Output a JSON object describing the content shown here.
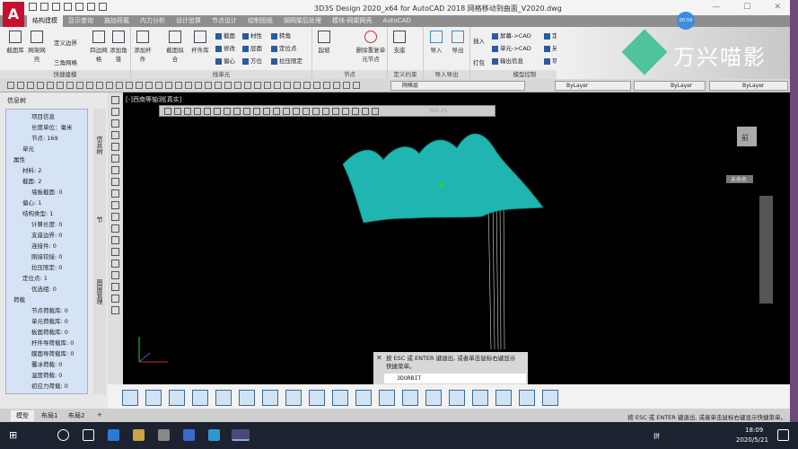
{
  "app": {
    "logo": "A",
    "title": "3D3S Design 2020_x64 for AutoCAD 2018     网格移动到曲面_V2020.dwg",
    "badge": "00:59",
    "watermark": "万兴喵影"
  },
  "tabs": [
    "结构建模",
    "显示查询",
    "施加荷载",
    "内力分析",
    "设计验算",
    "节点设计",
    "绘制图纸",
    "钢网架后处理",
    "模块-网架网壳",
    "AutoCAD"
  ],
  "ribbon": {
    "quick": {
      "title": "快捷建模",
      "buttons": [
        "截面库",
        "网架网壳",
        "定义边界",
        "三角网格",
        "四边网格",
        "添加角锥"
      ]
    },
    "line": {
      "title": "线单元",
      "buttons": [
        "添加杆件",
        "截面拟合",
        "杆件库",
        "截面",
        "修改",
        "偏心",
        "材性",
        "层面",
        "方位",
        "转角",
        "定位点",
        "拉压限定"
      ]
    },
    "node": {
      "title": "节点",
      "buttons": [
        "起坡",
        "删除重复单元节点"
      ]
    },
    "constraint": {
      "title": "定义约束",
      "buttons": [
        "支座"
      ]
    },
    "io": {
      "title": "导入导出",
      "buttons": [
        "导入",
        "导出"
      ]
    },
    "model": {
      "title": "模型控制",
      "buttons": [
        "插入",
        "打包",
        "屏幕->CAD",
        "单元->CAD",
        "输出信息",
        "定时备份",
        "另存为",
        "项目信息"
      ]
    }
  },
  "toolbar": {
    "layer": "网格层",
    "bylayer1": "ByLayer",
    "bylayer2": "ByLayer",
    "bylayer3": "ByLayer"
  },
  "left_panel": {
    "title": "信息树",
    "side_tabs": [
      "信息树",
      "节",
      "图层管理"
    ],
    "tree": [
      "项目信息",
      "长度单位：毫米",
      "节点:  169",
      "单元",
      "属性",
      "材料: 2",
      "截面:  2",
      "墙板截面: 0",
      "偏心: 1",
      "结构类型: 1",
      "计算长度: 0",
      "支座边界: 0",
      "连接件: 0",
      "刚接铰接: 0",
      "拉压限定: 0",
      "定位点: 1",
      "优选组: 0",
      "荷载",
      "节点荷载库: 0",
      "单元荷载库: 0",
      "板面荷载库: 0",
      "杆件导荷载库: 0",
      "膜面导荷载库: 0",
      "覆冰荷载: 0",
      "温度荷载: 0",
      "初应力荷载: 0"
    ]
  },
  "viewport": {
    "label": "[-]西南等轴测[真实]",
    "dimstyle": "ISO-25",
    "viewcube": "前",
    "wcs": "未命名"
  },
  "command": {
    "message": "按 ESC 或 ENTER 键退出, 或者单击鼠标右键显示快捷菜单。",
    "input": "3DORBIT"
  },
  "layout_tabs": [
    "模型",
    "布局1",
    "布局2",
    "+"
  ],
  "status_text": "按 ESC 或 ENTER 键退出, 或者单击鼠标右键显示快捷菜单。",
  "taskbar": {
    "lang": "拼",
    "time": "18:09",
    "date": "2020/5/21"
  },
  "colors": {
    "accent": "#c8102e",
    "surface": "#1fb5b0",
    "canvas": "#000000"
  }
}
